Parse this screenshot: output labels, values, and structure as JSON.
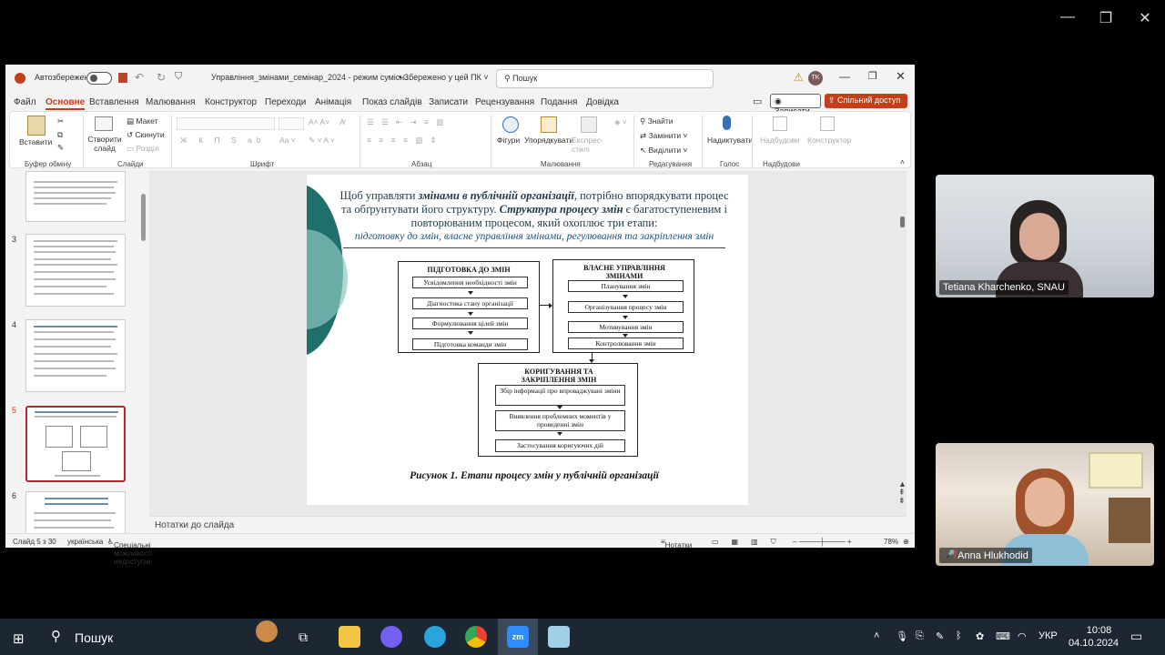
{
  "ppt": {
    "autosave_label": "Автозбереження",
    "doc_title": "Управління_змінами_семінар_2024  -  режим сумісн...",
    "saved_state": "• Збережено у цей ПК ˅",
    "search_placeholder": "Пошук",
    "user_initials": "TK",
    "menu": [
      "Файл",
      "Основне",
      "Вставлення",
      "Малювання",
      "Конструктор",
      "Переходи",
      "Анімація",
      "Показ слайдів",
      "Записати",
      "Рецензування",
      "Подання",
      "Довідка"
    ],
    "record_label": "Записати",
    "share_label": "Спільний доступ ˅",
    "ribbon": {
      "paste": "Вставити",
      "create_slide": "Створити слайд",
      "layout": "Макет",
      "reset": "Скинути",
      "section": "Розділ",
      "shapes": "Фігури",
      "arrange": "Упорядкувати",
      "express_styles": "Експрес-стилі",
      "find": "Знайти",
      "replace": "Замінити",
      "select": "Виділити",
      "dictate": "Надиктувати",
      "designer": "Надбудови",
      "constructor": "Конструктор",
      "groups": [
        "Буфер обміну",
        "Слайди",
        "Шрифт",
        "Абзац",
        "Малювання",
        "Редагування",
        "Голос",
        "Надбудови"
      ]
    },
    "thumbs": [
      {
        "num": "3"
      },
      {
        "num": "4"
      },
      {
        "num": "5"
      },
      {
        "num": "6"
      }
    ],
    "slide": {
      "intro_1": "Щоб управляти ",
      "intro_em": "змінами в публічній організації",
      "intro_2": ", потрібно впорядкувати процес та обґрунтувати його структуру. ",
      "intro_em2": "Структура процесу змін",
      "intro_3": " є багатоступеневим і повторюваним процесом, який охоплює три етапи:",
      "subtitle": "підготовку до змін, власне управління змінами, регулювання та закріплення змін",
      "box1": {
        "title": "ПІДГОТОВКА ДО ЗМІН",
        "items": [
          "Усвідомлення необхідності змін",
          "Діагностика стану організації",
          "Формулювання цілей змін",
          "Підготовка команди змін"
        ]
      },
      "box2": {
        "title": "ВЛАСНЕ УПРАВЛІННЯ ЗМІНАМИ",
        "items": [
          "Планування змін",
          "Організування процесу змін",
          "Мотивування змін",
          "Контролювання змін"
        ]
      },
      "box3": {
        "title": "КОРИГУВАННЯ ТА ЗАКРІПЛЕННЯ ЗМІН",
        "items": [
          "Збір інформації про впроваджувані зміни",
          "Виявлення проблемних моментів у проведенні змін",
          "Застосування коригуючих дій"
        ]
      },
      "caption": "Рисунок 1. Етапи процесу змін у публічній організації"
    },
    "notes_label": "Нотатки до слайда",
    "status": {
      "slide_counter": "Слайд 5 з 30",
      "language": "українська",
      "accessibility": "Спеціальні можливості: недоступні",
      "notes_btn": "Нотатки",
      "zoom": "78%"
    }
  },
  "participants": [
    {
      "name": "Tetiana Kharchenko, SNAU"
    },
    {
      "name": "Anna Hlukhodid"
    }
  ],
  "taskbar": {
    "search": "Пошук",
    "lang": "УКР",
    "time": "10:08",
    "date": "04.10.2024"
  }
}
